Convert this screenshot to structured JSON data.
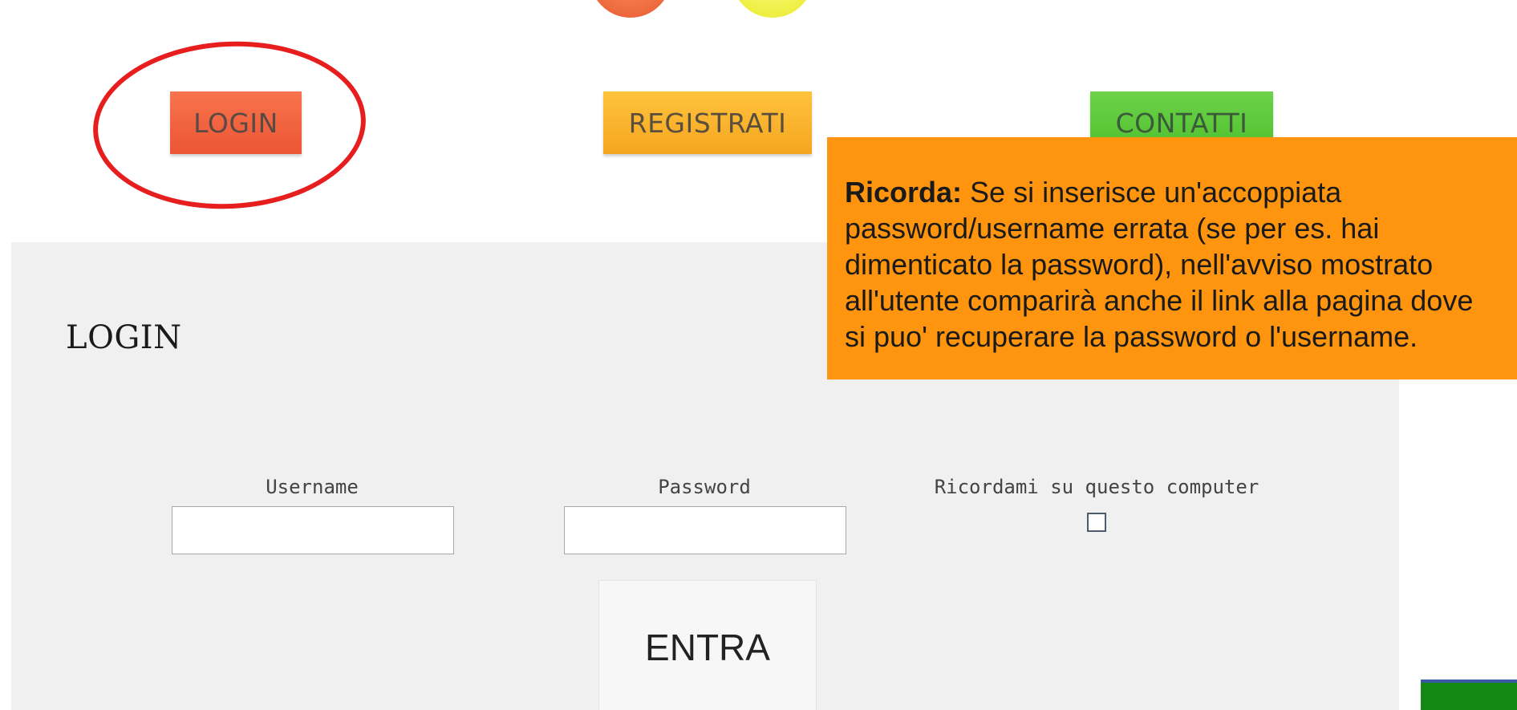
{
  "nav": {
    "login_label": "LOGIN",
    "register_label": "REGISTRATI",
    "contact_label": "CONTATTI"
  },
  "login_panel": {
    "title": "LOGIN",
    "username_label": "Username",
    "password_label": "Password",
    "remember_label": "Ricordami su questo computer",
    "username_value": "",
    "password_value": "",
    "remember_checked": false,
    "submit_label": "ENTRA"
  },
  "callout": {
    "bold_prefix": "Ricorda:",
    "text": " Se si inserisce un'accoppiata password/username errata (se per es. hai dimenticato la password), nell'avviso mostrato all'utente comparirà anche il link alla pagina dove si puo' recuperare la password o l'username."
  },
  "colors": {
    "login_button": "#ec5533",
    "register_button": "#f5a521",
    "contact_button": "#4dbf2c",
    "callout_background": "#ff950e",
    "highlight_ellipse": "#e61e1e",
    "panel_background": "#f0f0f0"
  }
}
